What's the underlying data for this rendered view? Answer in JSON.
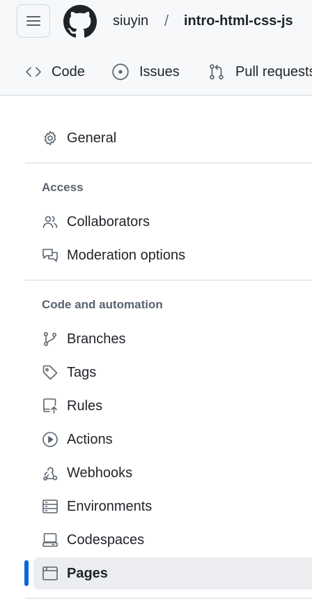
{
  "header": {
    "owner": "siuyin",
    "separator": "/",
    "repo": "intro-html-css-js"
  },
  "tabs": [
    {
      "label": "Code",
      "icon": "code-icon"
    },
    {
      "label": "Issues",
      "icon": "issue-opened-icon"
    },
    {
      "label": "Pull requests",
      "icon": "git-pull-request-icon"
    }
  ],
  "nav": {
    "general": {
      "label": "General",
      "icon": "gear-icon"
    },
    "access": {
      "title": "Access",
      "items": [
        {
          "label": "Collaborators",
          "icon": "people-icon"
        },
        {
          "label": "Moderation options",
          "icon": "comment-discussion-icon"
        }
      ]
    },
    "code_automation": {
      "title": "Code and automation",
      "items": [
        {
          "label": "Branches",
          "icon": "git-branch-icon"
        },
        {
          "label": "Tags",
          "icon": "tag-icon"
        },
        {
          "label": "Rules",
          "icon": "repo-push-icon"
        },
        {
          "label": "Actions",
          "icon": "play-icon"
        },
        {
          "label": "Webhooks",
          "icon": "webhook-icon"
        },
        {
          "label": "Environments",
          "icon": "server-icon"
        },
        {
          "label": "Codespaces",
          "icon": "codespaces-icon"
        },
        {
          "label": "Pages",
          "icon": "browser-icon",
          "active": true
        }
      ]
    }
  },
  "colors": {
    "accent": "#0969da",
    "header_bg": "#f6f8fa",
    "active_bg": "#ebedf0",
    "muted_text": "#59636e"
  }
}
